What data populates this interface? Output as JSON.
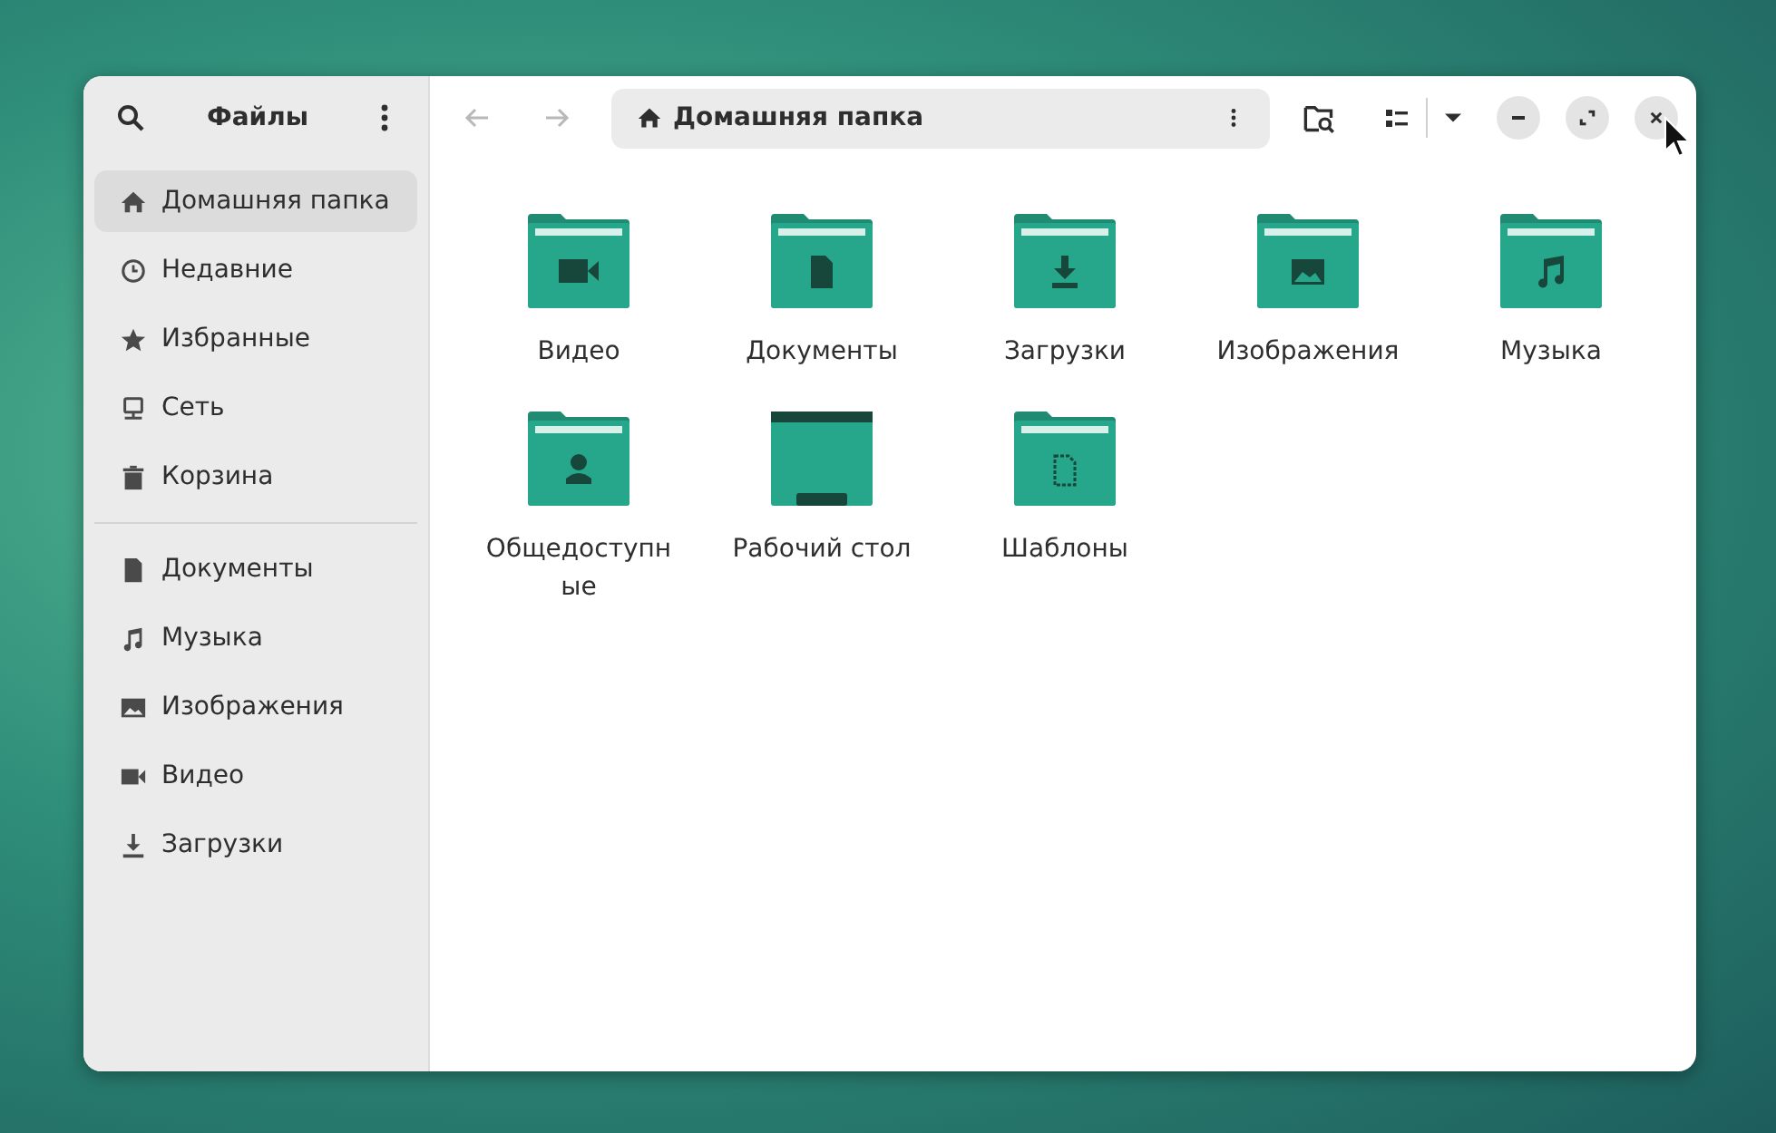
{
  "sidebar": {
    "title": "Файлы",
    "places": [
      {
        "kind": "home",
        "label": "Домашняя папка",
        "selected": true
      },
      {
        "kind": "recent",
        "label": "Недавние",
        "selected": false
      },
      {
        "kind": "starred",
        "label": "Избранные",
        "selected": false
      },
      {
        "kind": "network",
        "label": "Сеть",
        "selected": false
      },
      {
        "kind": "trash",
        "label": "Корзина",
        "selected": false
      }
    ],
    "bookmarks": [
      {
        "kind": "documents",
        "label": "Документы",
        "selected": false
      },
      {
        "kind": "music",
        "label": "Музыка",
        "selected": false
      },
      {
        "kind": "pictures",
        "label": "Изображения",
        "selected": false
      },
      {
        "kind": "videos",
        "label": "Видео",
        "selected": false
      },
      {
        "kind": "downloads",
        "label": "Загрузки",
        "selected": false
      }
    ]
  },
  "toolbar": {
    "back_disabled": true,
    "forward_disabled": true,
    "path": "Домашняя папка"
  },
  "folders": [
    {
      "kind": "videos",
      "name": "Видео"
    },
    {
      "kind": "documents",
      "name": "Документы"
    },
    {
      "kind": "downloads",
      "name": "Загрузки"
    },
    {
      "kind": "pictures",
      "name": "Изображения"
    },
    {
      "kind": "music",
      "name": "Музыка"
    },
    {
      "kind": "public",
      "name": "Общедоступные"
    },
    {
      "kind": "desktop",
      "name": "Рабочий стол"
    },
    {
      "kind": "templates",
      "name": "Шаблоны"
    }
  ]
}
